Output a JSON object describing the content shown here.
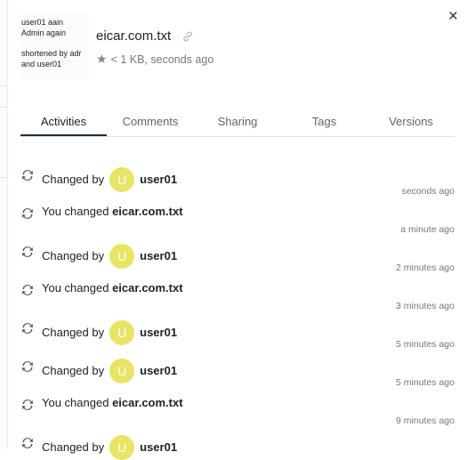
{
  "sidebar": {
    "file_title": "eicar.com.txt",
    "meta_text": "< 1 KB, seconds ago",
    "preview_text_1": "user01 aain",
    "preview_text_2": "Admin again",
    "preview_text_3": "shortened by adr",
    "preview_text_4": "and user01",
    "close_symbol": "×"
  },
  "tabs": [
    {
      "label": "Activities",
      "active": true
    },
    {
      "label": "Comments"
    },
    {
      "label": "Sharing"
    },
    {
      "label": "Tags"
    },
    {
      "label": "Versions"
    }
  ],
  "activities": [
    {
      "prefix": "Changed by",
      "user": "user01",
      "avatar": "U",
      "time": "seconds ago"
    },
    {
      "prefix": "You changed",
      "file": "eicar.com.txt",
      "time": "a minute ago"
    },
    {
      "prefix": "Changed by",
      "user": "user01",
      "avatar": "U",
      "time": "2 minutes ago"
    },
    {
      "prefix": "You changed",
      "file": "eicar.com.txt",
      "time": "3 minutes ago"
    },
    {
      "prefix": "Changed by",
      "user": "user01",
      "avatar": "U",
      "time": "5 minutes ago"
    },
    {
      "prefix": "Changed by",
      "user": "user01",
      "avatar": "U",
      "time": "5 minutes ago"
    },
    {
      "prefix": "You changed",
      "file": "eicar.com.txt",
      "time": "9 minutes ago"
    },
    {
      "prefix": "Changed by",
      "user": "user01",
      "avatar": "U",
      "time": ""
    }
  ],
  "colors": {
    "avatar_bg": "#e8e465",
    "active_tab_underline": "#1d2d44"
  }
}
